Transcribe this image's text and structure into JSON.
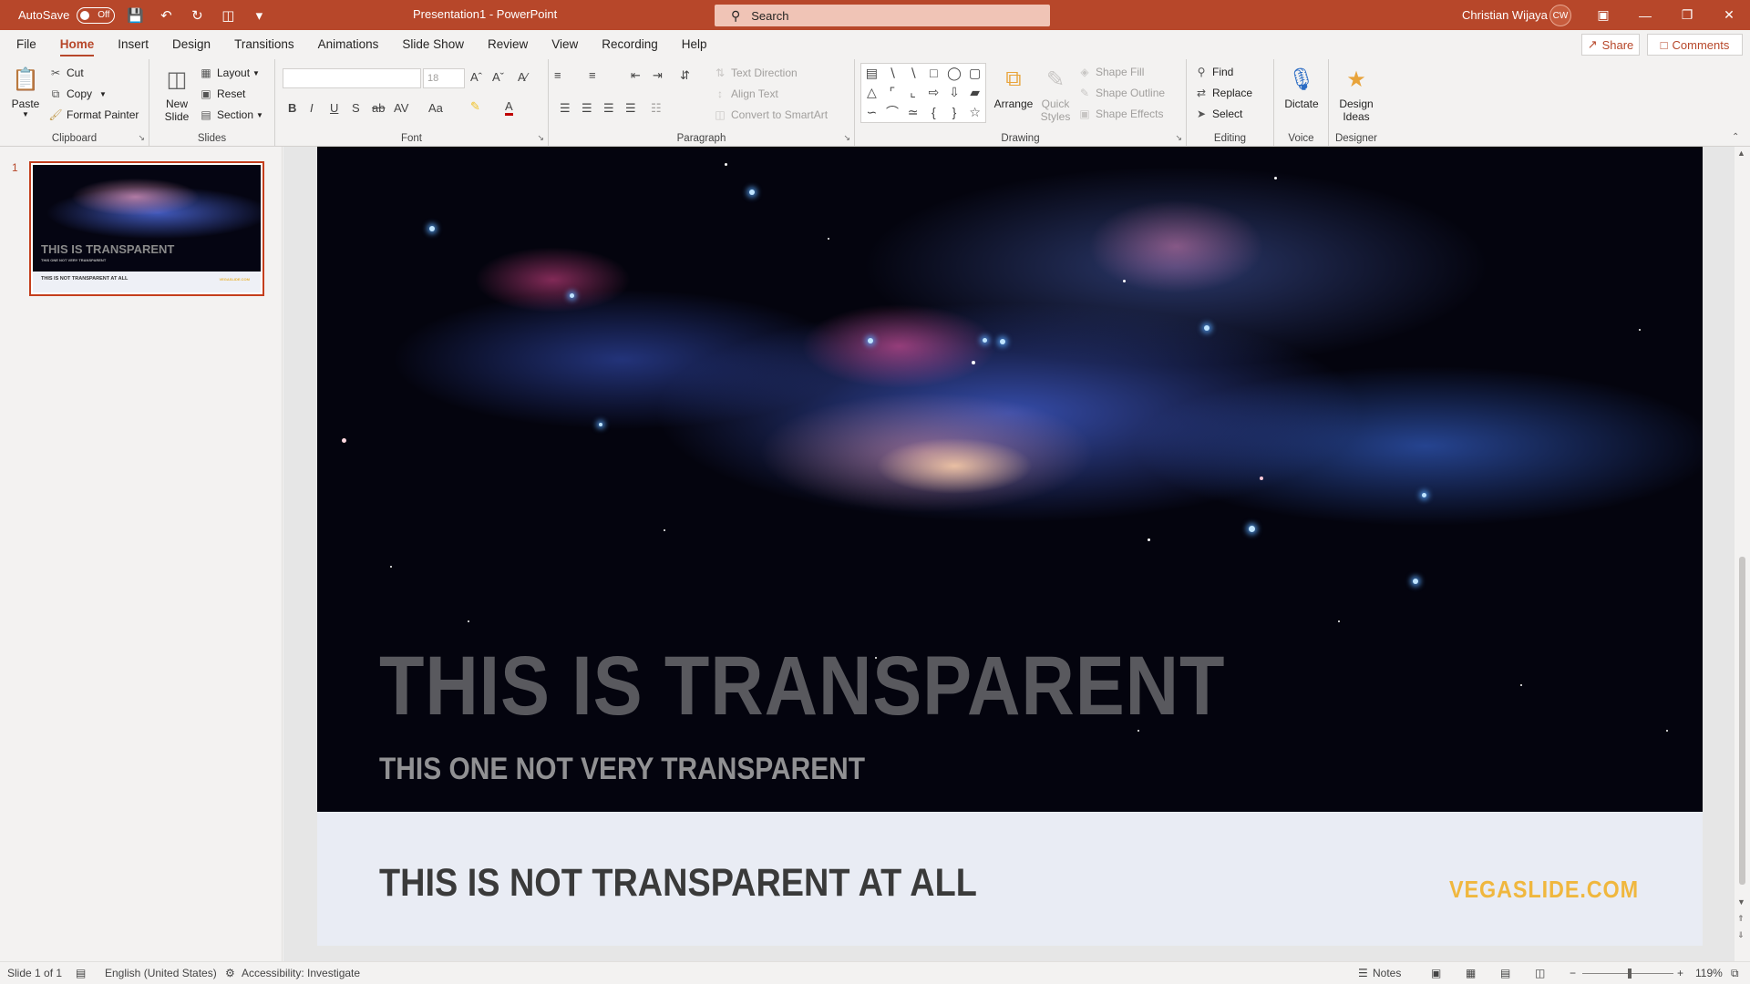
{
  "titlebar": {
    "autosave_label": "AutoSave",
    "autosave_state": "Off",
    "doc_title": "Presentation1  -  PowerPoint",
    "search_placeholder": "Search",
    "user_name": "Christian Wijaya",
    "user_initials": "CW",
    "accent": "#b7472a"
  },
  "tabs": [
    "File",
    "Home",
    "Insert",
    "Design",
    "Transitions",
    "Animations",
    "Slide Show",
    "Review",
    "View",
    "Recording",
    "Help"
  ],
  "active_tab": "Home",
  "share_label": "Share",
  "comments_label": "Comments",
  "ribbon": {
    "clipboard": {
      "label": "Clipboard",
      "paste": "Paste",
      "cut": "Cut",
      "copy": "Copy",
      "format_painter": "Format Painter"
    },
    "slides": {
      "label": "Slides",
      "new_slide_1": "New",
      "new_slide_2": "Slide",
      "layout": "Layout",
      "reset": "Reset",
      "section": "Section"
    },
    "font": {
      "label": "Font",
      "font_size": "18"
    },
    "paragraph": {
      "label": "Paragraph",
      "text_direction": "Text Direction",
      "align_text": "Align Text",
      "smartart": "Convert to SmartArt"
    },
    "drawing": {
      "label": "Drawing",
      "arrange": "Arrange",
      "quick_styles_1": "Quick",
      "quick_styles_2": "Styles",
      "shape_fill": "Shape Fill",
      "shape_outline": "Shape Outline",
      "shape_effects": "Shape Effects"
    },
    "editing": {
      "label": "Editing",
      "find": "Find",
      "replace": "Replace",
      "select": "Select"
    },
    "voice": {
      "label": "Voice",
      "dictate": "Dictate"
    },
    "designer": {
      "label": "Designer",
      "design_ideas_1": "Design",
      "design_ideas_2": "Ideas"
    }
  },
  "thumbnail": {
    "number": "1",
    "t1": "THIS IS TRANSPARENT",
    "t2": "THIS ONE NOT VERY TRANSPARENT",
    "t3": "THIS IS NOT TRANSPARENT AT ALL",
    "t4": "VEGASLIDE.COM"
  },
  "slide": {
    "title": "THIS IS TRANSPARENT",
    "subtitle": "THIS ONE NOT VERY TRANSPARENT",
    "footer_title": "THIS IS NOT TRANSPARENT AT ALL",
    "brand": "VEGASLIDE.COM",
    "brand_color": "#f0b73e"
  },
  "statusbar": {
    "slide_info": "Slide 1 of 1",
    "language": "English (United States)",
    "accessibility": "Accessibility: Investigate",
    "notes": "Notes",
    "zoom": "119%"
  }
}
